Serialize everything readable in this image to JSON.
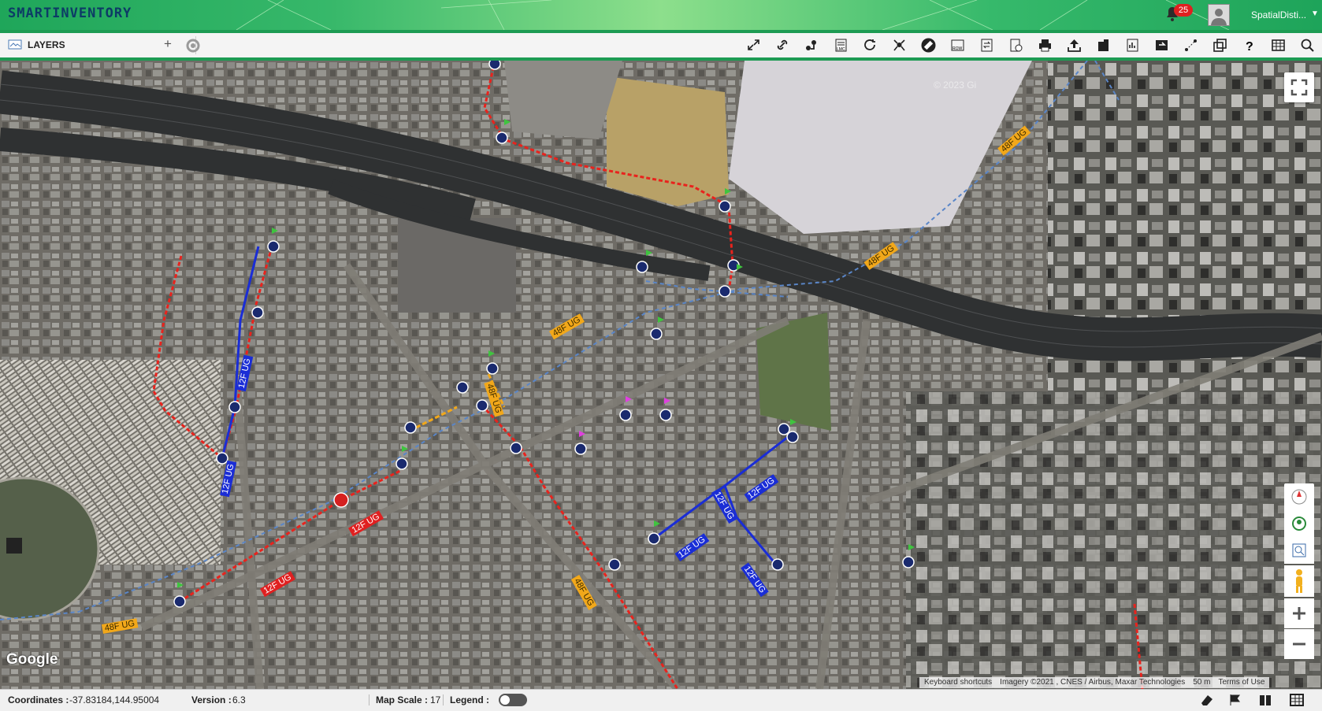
{
  "header": {
    "logo": "SMARTINVENTORY",
    "notifications_count": "25",
    "user_name": "SpatialDisti..."
  },
  "toolbar": {
    "layers_label": "LAYERS",
    "add_label": "+",
    "tools": [
      "expand-arrows-icon",
      "link-icon",
      "route-icon",
      "lmc-icon",
      "refresh-icon",
      "network-icon",
      "ruler-icon",
      "row-icon",
      "loop-icon",
      "report-icon",
      "print-icon",
      "upload-icon",
      "building-icon",
      "document-icon",
      "export-icon",
      "measure-icon",
      "layers-icon",
      "help-icon",
      "table-icon",
      "search-icon"
    ]
  },
  "map": {
    "google_label": "Google",
    "attribution": [
      "Keyboard shortcuts",
      "Imagery ©2021 , CNES / Airbus, Maxar Technologies",
      "50 m",
      "Terms of Use"
    ],
    "watermark": "© 2023 Gi",
    "cable_labels": [
      {
        "text": "12F UG",
        "color": "#1a2dd6"
      },
      {
        "text": "12F UG",
        "color": "#1a2dd6"
      },
      {
        "text": "48F UG",
        "color": "#f2a81a"
      },
      {
        "text": "48F UG",
        "color": "#f2a81a"
      },
      {
        "text": "48F UG",
        "color": "#f2a81a"
      },
      {
        "text": "48F UG",
        "color": "#f2a81a"
      },
      {
        "text": "12F UG",
        "color": "#1a2dd6"
      },
      {
        "text": "12F UG",
        "color": "#1a2dd6"
      },
      {
        "text": "12F UG",
        "color": "#1a2dd6"
      },
      {
        "text": "12F UG",
        "color": "#1a2dd6"
      },
      {
        "text": "12F UG",
        "color": "#e02020"
      },
      {
        "text": "12F UG",
        "color": "#e02020"
      },
      {
        "text": "48F UG",
        "color": "#f2a81a"
      },
      {
        "text": "48F UG",
        "color": "#f2a81a"
      }
    ],
    "colors": {
      "red_route": "#e8231d",
      "blue_route": "#1a2dd6",
      "dash_route": "#5a86c8",
      "node": "#1a2a6e",
      "flag": "#3fc43f"
    }
  },
  "footer": {
    "coordinates_label": "Coordinates :",
    "coordinates_value": "-37.83184,144.95004",
    "version_label": "Version :",
    "version_value": "6.3",
    "map_scale_label": "Map Scale :",
    "map_scale_value": "17",
    "legend_label": "Legend :"
  }
}
